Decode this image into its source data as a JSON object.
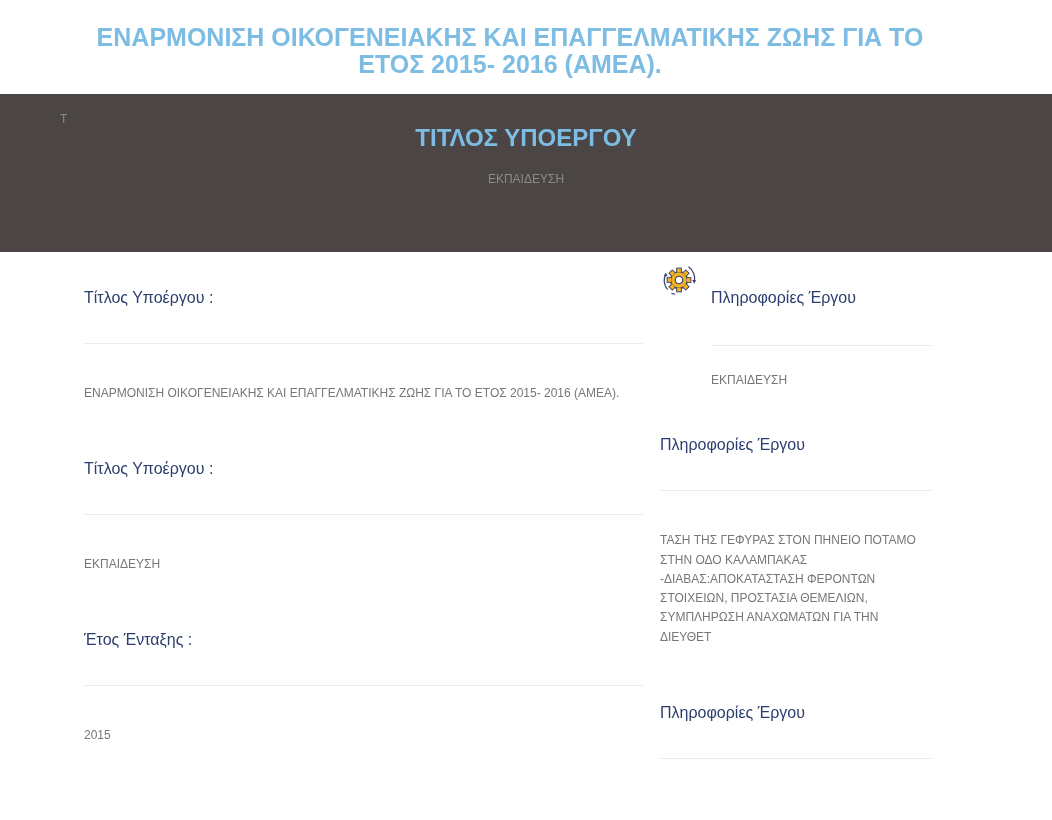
{
  "page_title": "ΕΝΑΡΜΟΝΙΣΗ ΟΙΚΟΓΕΝΕΙΑΚΗΣ ΚΑΙ ΕΠΑΓΓΕΛΜΑΤΙΚΗΣ ΖΩΗΣ ΓΙΑ ΤΟ ΕΤΟΣ 2015- 2016 (ΑΜΕΑ).",
  "banner": {
    "corner_text": "Τ",
    "title": "ΤΙΤΛΟΣ ΥΠΟΕΡΓΟΥ",
    "subtitle": "ΕΚΠΑΙΔΕΥΣΗ"
  },
  "details": [
    {
      "label": "Τίτλος Υποέργου :",
      "value": "ΕΝΑΡΜΟΝΙΣΗ ΟΙΚΟΓΕΝΕΙΑΚΗΣ ΚΑΙ ΕΠΑΓΓΕΛΜΑΤΙΚΗΣ ΖΩΗΣ ΓΙΑ ΤΟ ΕΤΟΣ 2015- 2016 (ΑΜΕΑ)."
    },
    {
      "label": "Τίτλος Υποέργου :",
      "value": "ΕΚΠΑΙΔΕΥΣΗ"
    },
    {
      "label": "Έτος Ένταξης :",
      "value": "2015"
    }
  ],
  "sidebar": [
    {
      "kind": "icon",
      "title": "Πληροφορίες Έργου",
      "value": "ΕΚΠΑΙΔΕΥΣΗ"
    },
    {
      "kind": "plain",
      "title": "Πληροφορίες Έργου",
      "value": "ΤΑΣΗ ΤΗΣ ΓΕΦΥΡΑΣ ΣΤΟΝ ΠΗΝΕΙΟ ΠΟΤΑΜΟ ΣΤΗΝ ΟΔΟ ΚΑΛΑΜΠΑΚΑΣ -ΔΙΑΒΑΣ:ΑΠΟΚΑΤΑΣΤΑΣΗ ΦΕΡΟΝΤΩΝ ΣΤΟΙΧΕΙΩΝ, ΠΡΟΣΤΑΣΙΑ ΘΕΜΕΛΙΩΝ, ΣΥΜΠΛΗΡΩΣΗ ΑΝΑΧΩΜΑΤΩΝ ΓΙΑ ΤΗΝ ΔΙΕΥΘΕΤ"
    },
    {
      "kind": "plain",
      "title": "Πληροφορίες Έργου"
    }
  ]
}
